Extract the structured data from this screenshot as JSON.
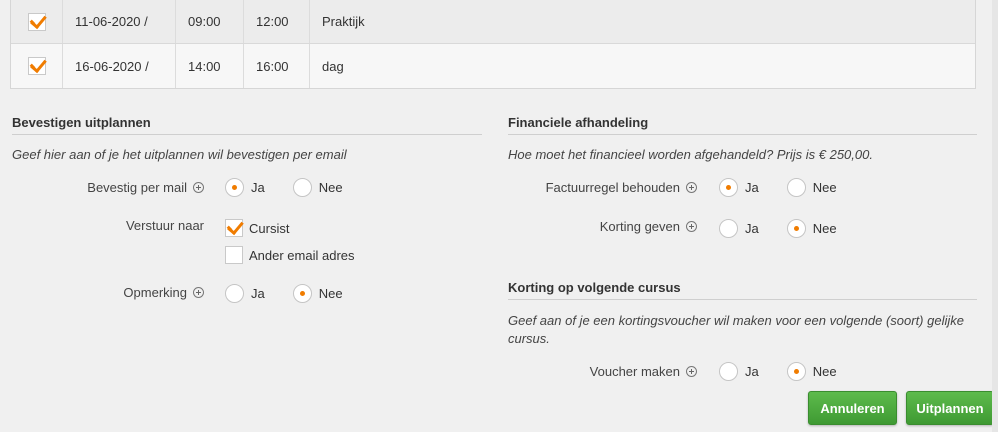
{
  "table": {
    "rows": [
      {
        "checked": true,
        "date": "11-06-2020 /",
        "start": "09:00",
        "end": "12:00",
        "desc": "Praktijk"
      },
      {
        "checked": true,
        "date": "16-06-2020 /",
        "start": "14:00",
        "end": "16:00",
        "desc": "dag"
      }
    ]
  },
  "confirm": {
    "title": "Bevestigen uitplannen",
    "hint": "Geef hier aan of je het uitplannen wil bevestigen per email",
    "mail_label": "Bevestig per mail",
    "send_label": "Verstuur naar",
    "remark_label": "Opmerking",
    "yes": "Ja",
    "no": "Nee",
    "cursist": "Cursist",
    "other_email": "Ander email adres"
  },
  "finance": {
    "title": "Financiele afhandeling",
    "hint": "Hoe moet het financieel worden afgehandeld? Prijs is € 250,00.",
    "invoice_label": "Factuurregel behouden",
    "discount_label": "Korting geven",
    "yes": "Ja",
    "no": "Nee"
  },
  "voucher": {
    "title": "Korting op volgende cursus",
    "hint": "Geef aan of je een kortingsvoucher wil maken voor een volgende (soort) gelijke cursus.",
    "label": "Voucher maken",
    "yes": "Ja",
    "no": "Nee"
  },
  "buttons": {
    "cancel": "Annuleren",
    "plan_out": "Uitplannen"
  },
  "colors": {
    "accent": "#f07c00",
    "button_green": "#4caf3e"
  }
}
